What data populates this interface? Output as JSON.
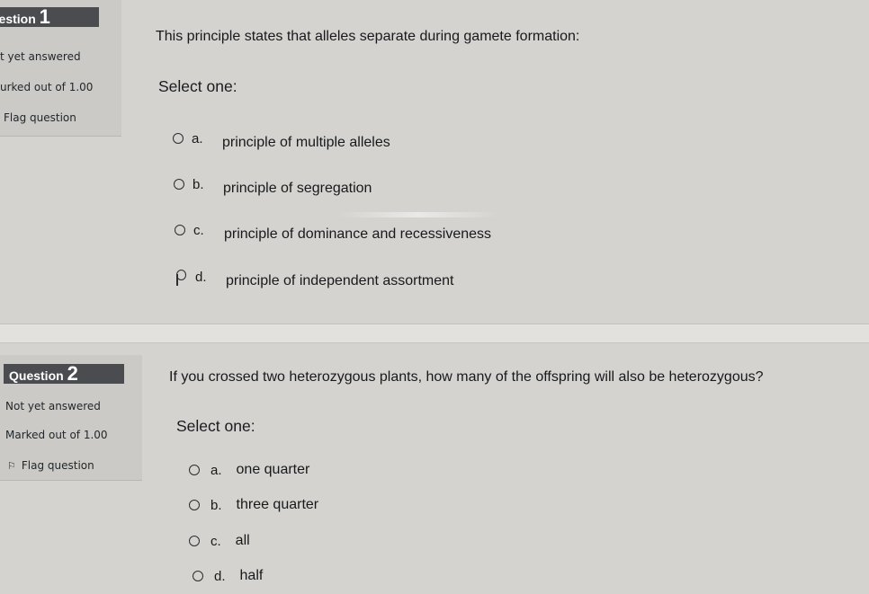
{
  "questions": [
    {
      "number_prefix": "uestion",
      "number": "1",
      "status": "t yet answered",
      "marks": "urked out of 1.00",
      "flag_label": "Flag question",
      "text": "This principle states that alleles separate during gamete formation:",
      "select_label": "Select one:",
      "options": [
        {
          "letter": "a.",
          "text": "principle of multiple alleles"
        },
        {
          "letter": "b.",
          "text": "principle of segregation"
        },
        {
          "letter": "c.",
          "text": "principle of dominance and recessiveness"
        },
        {
          "letter": "d.",
          "text": "principle of independent assortment"
        }
      ]
    },
    {
      "number_prefix": "Question",
      "number": "2",
      "status": "Not yet answered",
      "marks": "Marked out of 1.00",
      "flag_label": "Flag question",
      "text": "If you crossed two heterozygous plants, how many of the offspring will also be heterozygous?",
      "select_label": "Select one:",
      "options": [
        {
          "letter": "a.",
          "text": "one quarter"
        },
        {
          "letter": "b.",
          "text": "three quarter"
        },
        {
          "letter": "c.",
          "text": "all"
        },
        {
          "letter": "d.",
          "text": "half"
        }
      ]
    }
  ],
  "icons": {
    "flag": "flag-icon",
    "cursor": "mouse-pointer-icon",
    "radio": "radio-button-icon"
  },
  "colors": {
    "page_bg": "#d4d3d0",
    "info_bg": "#cbcac6",
    "qno_bg": "#4b4c50",
    "text": "#18191b"
  }
}
